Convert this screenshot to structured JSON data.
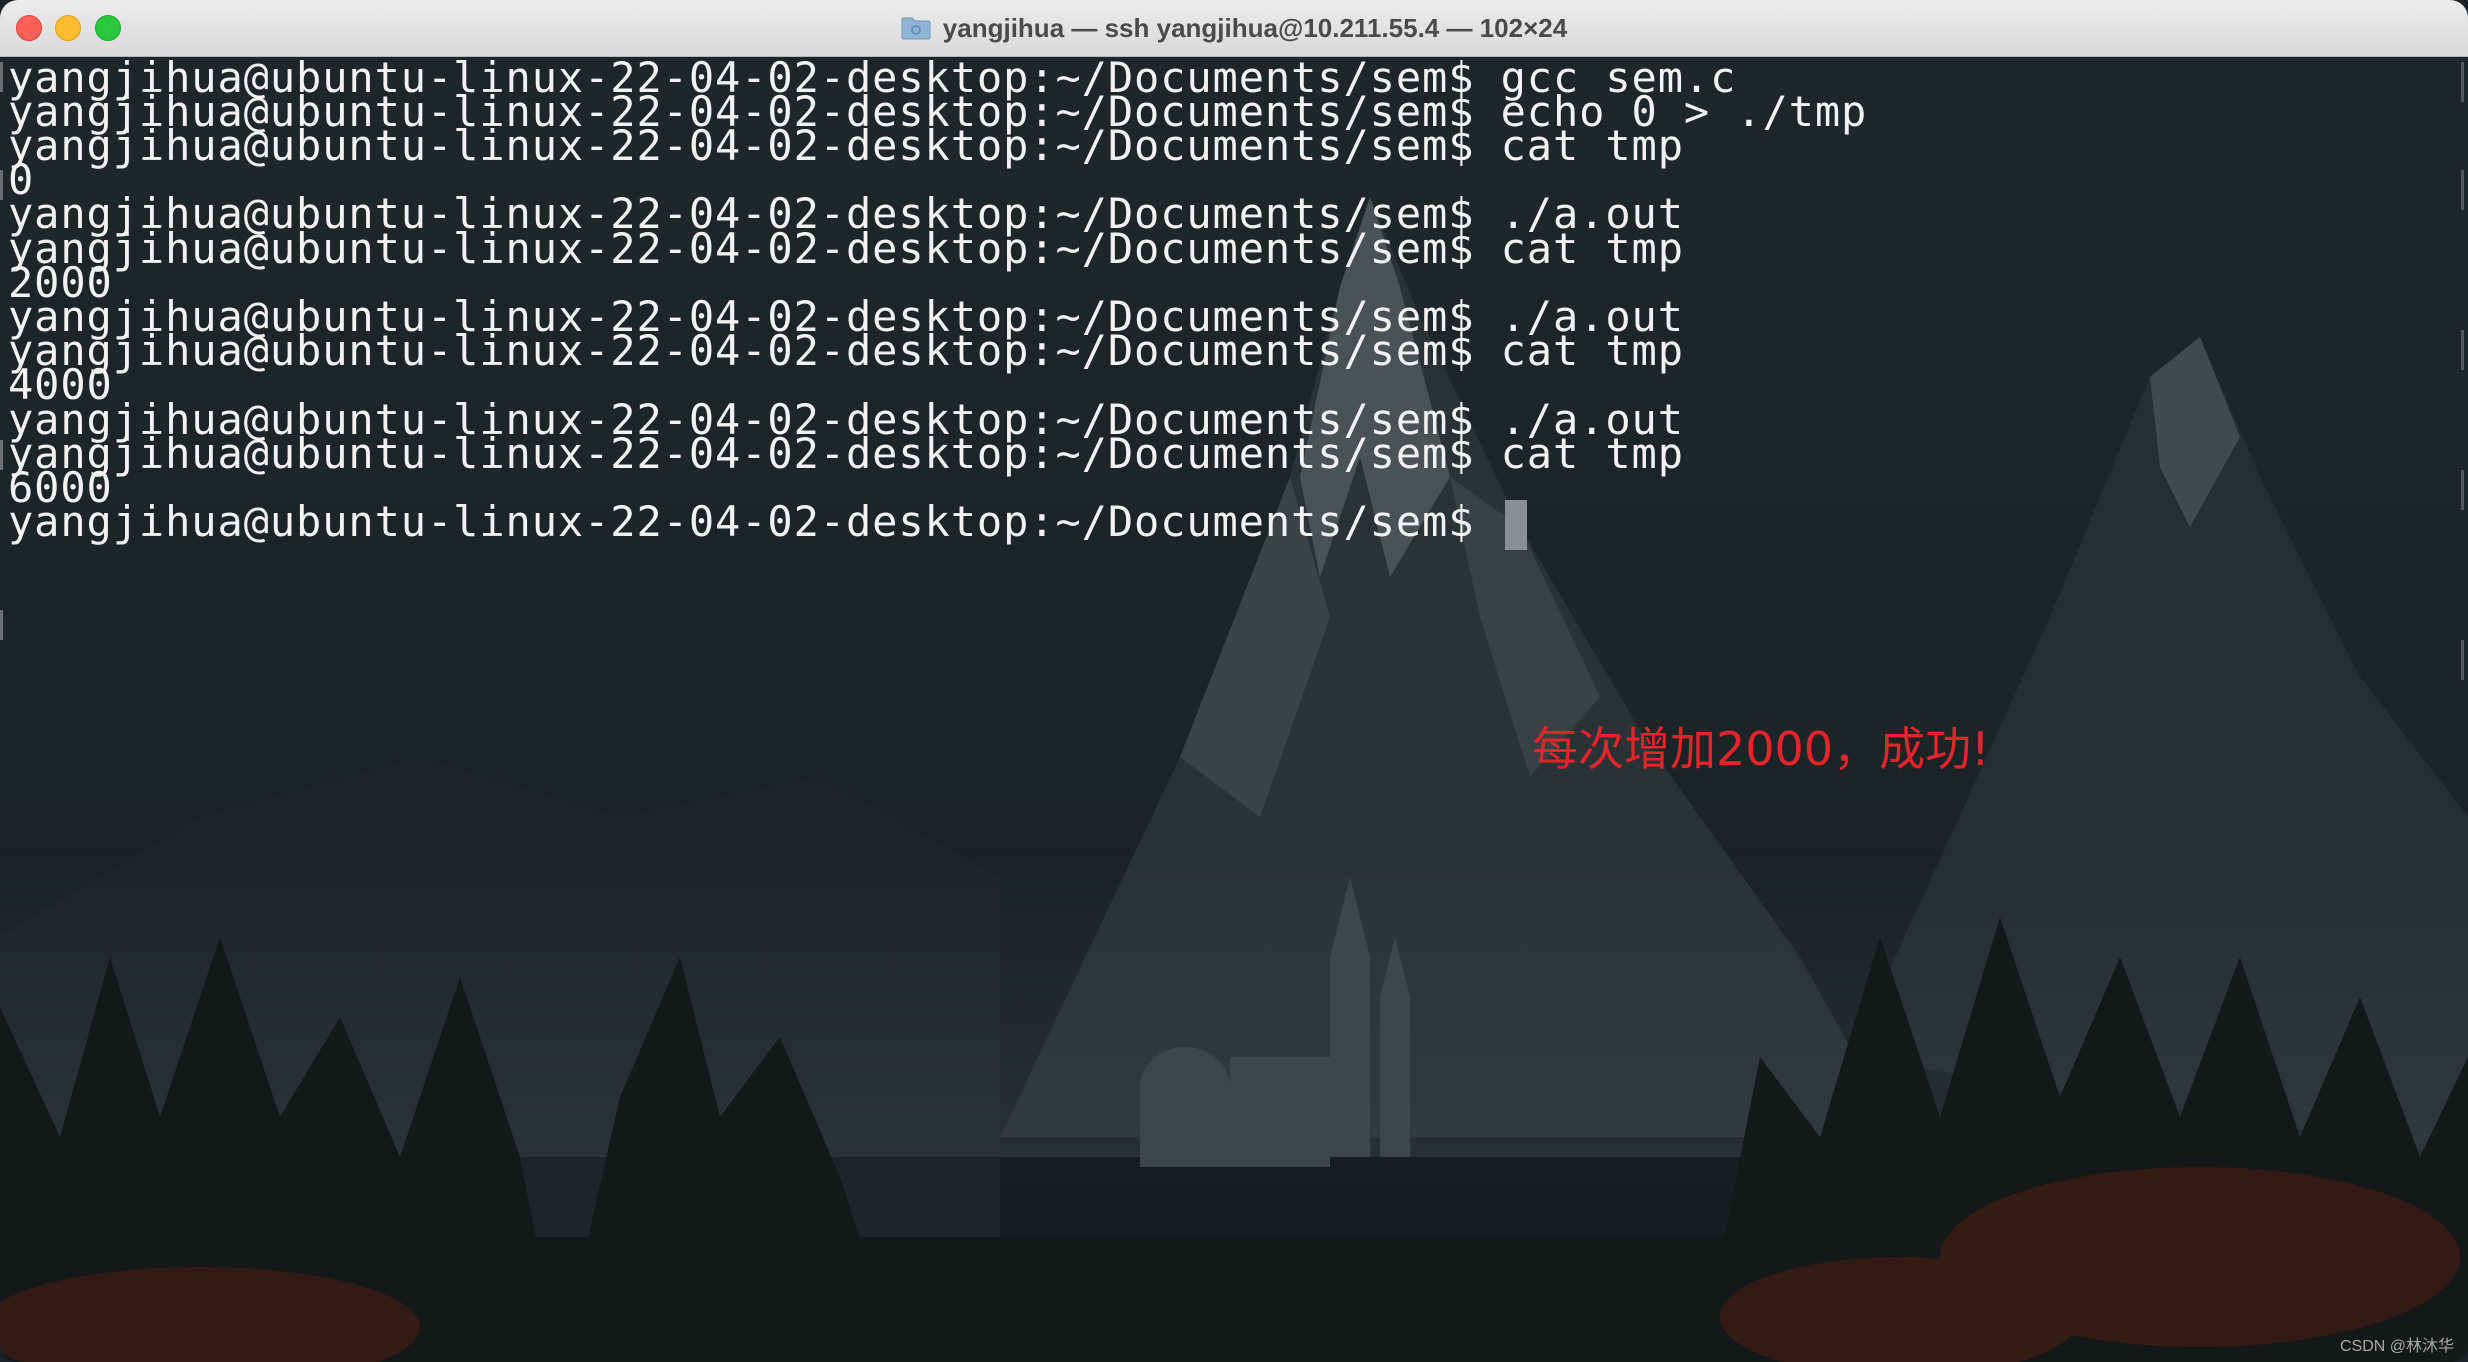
{
  "window": {
    "title": "yangjihua — ssh yangjihua@10.211.55.4 — 102×24"
  },
  "terminal": {
    "lines": [
      "yangjihua@ubuntu-linux-22-04-02-desktop:~/Documents/sem$ gcc sem.c",
      "yangjihua@ubuntu-linux-22-04-02-desktop:~/Documents/sem$ echo 0 > ./tmp",
      "yangjihua@ubuntu-linux-22-04-02-desktop:~/Documents/sem$ cat tmp",
      "0",
      "yangjihua@ubuntu-linux-22-04-02-desktop:~/Documents/sem$ ./a.out",
      "yangjihua@ubuntu-linux-22-04-02-desktop:~/Documents/sem$ cat tmp",
      "2000",
      "yangjihua@ubuntu-linux-22-04-02-desktop:~/Documents/sem$ ./a.out",
      "yangjihua@ubuntu-linux-22-04-02-desktop:~/Documents/sem$ cat tmp",
      "4000",
      "yangjihua@ubuntu-linux-22-04-02-desktop:~/Documents/sem$ ./a.out",
      "yangjihua@ubuntu-linux-22-04-02-desktop:~/Documents/sem$ cat tmp",
      "6000"
    ],
    "prompt": "yangjihua@ubuntu-linux-22-04-02-desktop:~/Documents/sem$ "
  },
  "annotation": {
    "text": "每次增加2000，成功!",
    "color": "#e3242b"
  },
  "watermark": "CSDN @林沐华",
  "colors": {
    "terminal_text": "#f2f2f2",
    "close": "#fe5f57",
    "minimize": "#febc2e",
    "maximize": "#28c840"
  }
}
